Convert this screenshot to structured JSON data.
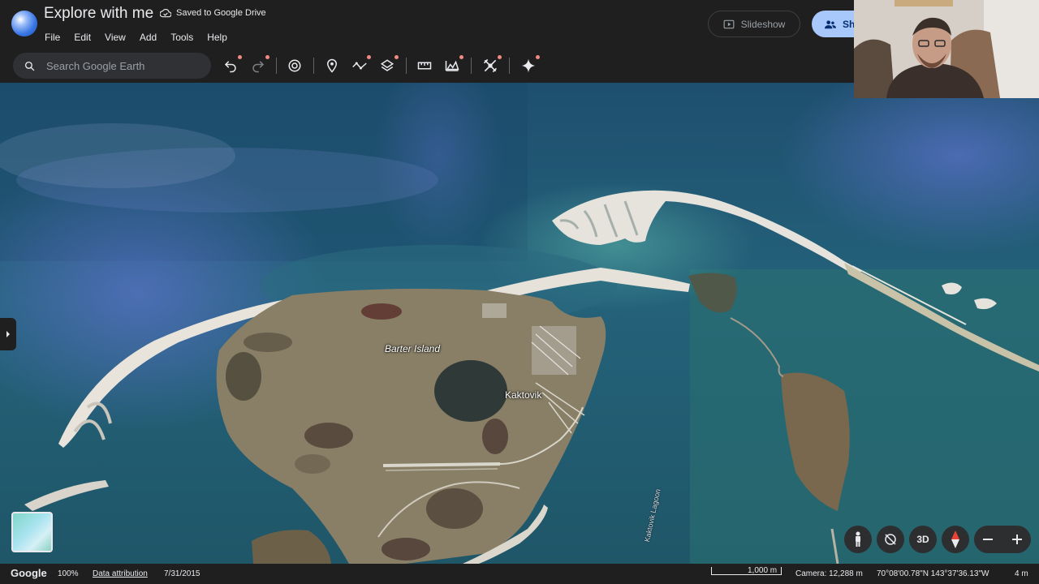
{
  "header": {
    "title": "Explore with me",
    "saved_status": "Saved to Google Drive",
    "menu": [
      "File",
      "Edit",
      "View",
      "Add",
      "Tools",
      "Help"
    ],
    "slideshow_label": "Slideshow",
    "share_label": "Sh"
  },
  "search": {
    "placeholder": "Search Google Earth"
  },
  "toolbar": {
    "tools": [
      "undo-icon",
      "redo-icon",
      "history-icon",
      "placemark-icon",
      "path-icon",
      "layers-icon",
      "measure-icon",
      "elevation-icon",
      "satellite-icon",
      "ai-sparkle-icon"
    ]
  },
  "map": {
    "labels": {
      "barter_island": "Barter Island",
      "kaktovik": "Kaktovik",
      "lagoon": "Kaktovik Lagoon"
    }
  },
  "controls": {
    "view_3d": "3D"
  },
  "statusbar": {
    "brand": "Google",
    "zoom": "100%",
    "attribution": "Data attribution",
    "date": "7/31/2015",
    "scale": "1,000 m",
    "camera": "Camera: 12,288 m",
    "coordinates": "70°08'00.78\"N 143°37'36.13\"W",
    "elevation": "4 m"
  },
  "colors": {
    "ocean_dark": "#1e5870",
    "ocean_light": "#2f7a86",
    "land": "#8a8166",
    "beach": "#e9e6df",
    "accent": "#a8c7fa"
  }
}
